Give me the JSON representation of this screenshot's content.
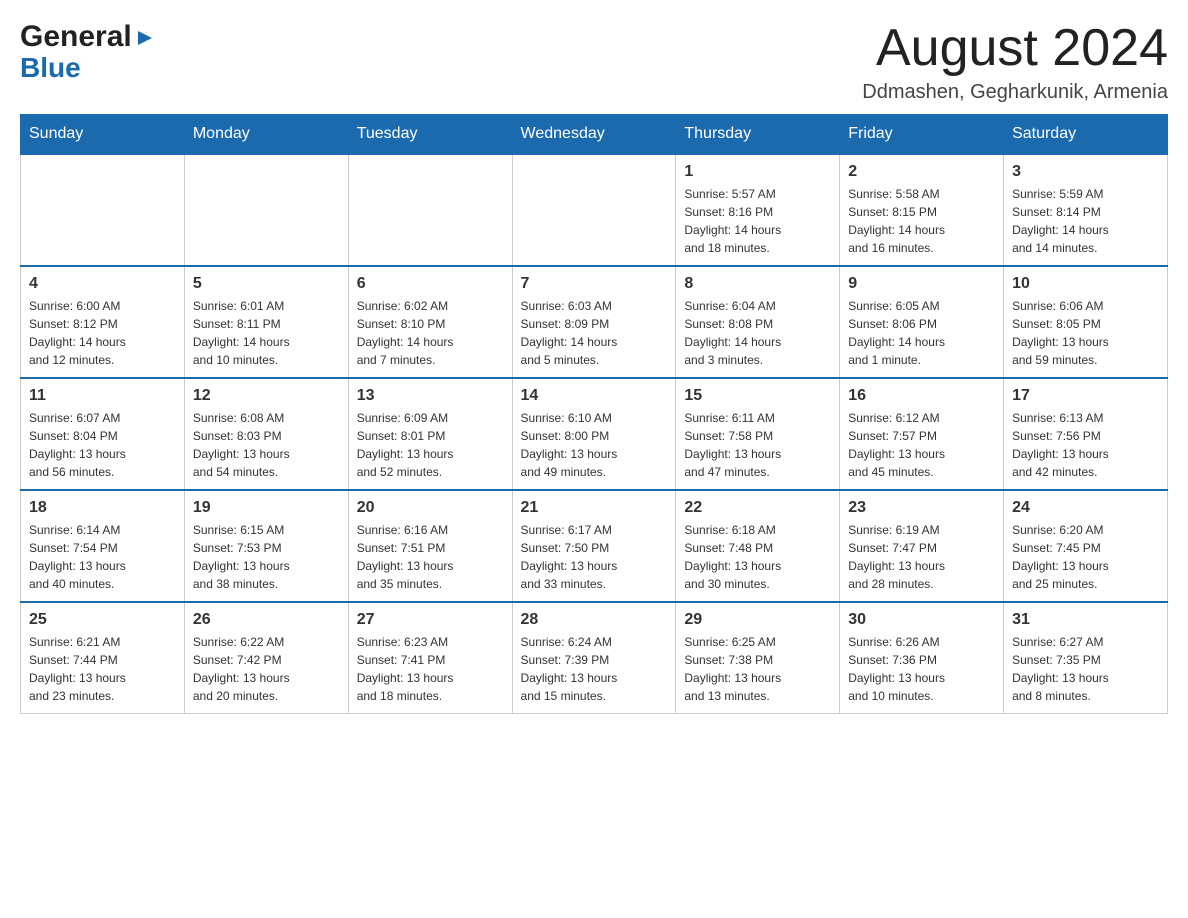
{
  "header": {
    "logo": {
      "general": "General",
      "blue": "Blue",
      "arrow": "▶"
    },
    "title": "August 2024",
    "location": "Ddmashen, Gegharkunik, Armenia"
  },
  "calendar": {
    "days_of_week": [
      "Sunday",
      "Monday",
      "Tuesday",
      "Wednesday",
      "Thursday",
      "Friday",
      "Saturday"
    ],
    "weeks": [
      [
        {
          "day": "",
          "info": ""
        },
        {
          "day": "",
          "info": ""
        },
        {
          "day": "",
          "info": ""
        },
        {
          "day": "",
          "info": ""
        },
        {
          "day": "1",
          "info": "Sunrise: 5:57 AM\nSunset: 8:16 PM\nDaylight: 14 hours\nand 18 minutes."
        },
        {
          "day": "2",
          "info": "Sunrise: 5:58 AM\nSunset: 8:15 PM\nDaylight: 14 hours\nand 16 minutes."
        },
        {
          "day": "3",
          "info": "Sunrise: 5:59 AM\nSunset: 8:14 PM\nDaylight: 14 hours\nand 14 minutes."
        }
      ],
      [
        {
          "day": "4",
          "info": "Sunrise: 6:00 AM\nSunset: 8:12 PM\nDaylight: 14 hours\nand 12 minutes."
        },
        {
          "day": "5",
          "info": "Sunrise: 6:01 AM\nSunset: 8:11 PM\nDaylight: 14 hours\nand 10 minutes."
        },
        {
          "day": "6",
          "info": "Sunrise: 6:02 AM\nSunset: 8:10 PM\nDaylight: 14 hours\nand 7 minutes."
        },
        {
          "day": "7",
          "info": "Sunrise: 6:03 AM\nSunset: 8:09 PM\nDaylight: 14 hours\nand 5 minutes."
        },
        {
          "day": "8",
          "info": "Sunrise: 6:04 AM\nSunset: 8:08 PM\nDaylight: 14 hours\nand 3 minutes."
        },
        {
          "day": "9",
          "info": "Sunrise: 6:05 AM\nSunset: 8:06 PM\nDaylight: 14 hours\nand 1 minute."
        },
        {
          "day": "10",
          "info": "Sunrise: 6:06 AM\nSunset: 8:05 PM\nDaylight: 13 hours\nand 59 minutes."
        }
      ],
      [
        {
          "day": "11",
          "info": "Sunrise: 6:07 AM\nSunset: 8:04 PM\nDaylight: 13 hours\nand 56 minutes."
        },
        {
          "day": "12",
          "info": "Sunrise: 6:08 AM\nSunset: 8:03 PM\nDaylight: 13 hours\nand 54 minutes."
        },
        {
          "day": "13",
          "info": "Sunrise: 6:09 AM\nSunset: 8:01 PM\nDaylight: 13 hours\nand 52 minutes."
        },
        {
          "day": "14",
          "info": "Sunrise: 6:10 AM\nSunset: 8:00 PM\nDaylight: 13 hours\nand 49 minutes."
        },
        {
          "day": "15",
          "info": "Sunrise: 6:11 AM\nSunset: 7:58 PM\nDaylight: 13 hours\nand 47 minutes."
        },
        {
          "day": "16",
          "info": "Sunrise: 6:12 AM\nSunset: 7:57 PM\nDaylight: 13 hours\nand 45 minutes."
        },
        {
          "day": "17",
          "info": "Sunrise: 6:13 AM\nSunset: 7:56 PM\nDaylight: 13 hours\nand 42 minutes."
        }
      ],
      [
        {
          "day": "18",
          "info": "Sunrise: 6:14 AM\nSunset: 7:54 PM\nDaylight: 13 hours\nand 40 minutes."
        },
        {
          "day": "19",
          "info": "Sunrise: 6:15 AM\nSunset: 7:53 PM\nDaylight: 13 hours\nand 38 minutes."
        },
        {
          "day": "20",
          "info": "Sunrise: 6:16 AM\nSunset: 7:51 PM\nDaylight: 13 hours\nand 35 minutes."
        },
        {
          "day": "21",
          "info": "Sunrise: 6:17 AM\nSunset: 7:50 PM\nDaylight: 13 hours\nand 33 minutes."
        },
        {
          "day": "22",
          "info": "Sunrise: 6:18 AM\nSunset: 7:48 PM\nDaylight: 13 hours\nand 30 minutes."
        },
        {
          "day": "23",
          "info": "Sunrise: 6:19 AM\nSunset: 7:47 PM\nDaylight: 13 hours\nand 28 minutes."
        },
        {
          "day": "24",
          "info": "Sunrise: 6:20 AM\nSunset: 7:45 PM\nDaylight: 13 hours\nand 25 minutes."
        }
      ],
      [
        {
          "day": "25",
          "info": "Sunrise: 6:21 AM\nSunset: 7:44 PM\nDaylight: 13 hours\nand 23 minutes."
        },
        {
          "day": "26",
          "info": "Sunrise: 6:22 AM\nSunset: 7:42 PM\nDaylight: 13 hours\nand 20 minutes."
        },
        {
          "day": "27",
          "info": "Sunrise: 6:23 AM\nSunset: 7:41 PM\nDaylight: 13 hours\nand 18 minutes."
        },
        {
          "day": "28",
          "info": "Sunrise: 6:24 AM\nSunset: 7:39 PM\nDaylight: 13 hours\nand 15 minutes."
        },
        {
          "day": "29",
          "info": "Sunrise: 6:25 AM\nSunset: 7:38 PM\nDaylight: 13 hours\nand 13 minutes."
        },
        {
          "day": "30",
          "info": "Sunrise: 6:26 AM\nSunset: 7:36 PM\nDaylight: 13 hours\nand 10 minutes."
        },
        {
          "day": "31",
          "info": "Sunrise: 6:27 AM\nSunset: 7:35 PM\nDaylight: 13 hours\nand 8 minutes."
        }
      ]
    ]
  }
}
